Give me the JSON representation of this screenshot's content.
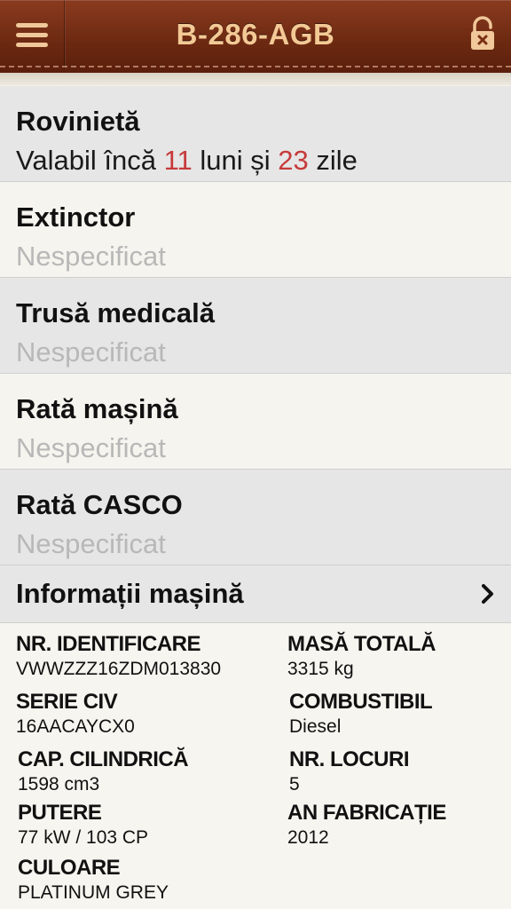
{
  "header": {
    "title": "B-286-AGB",
    "menu_icon": "hamburger-menu-icon",
    "lock_icon": "lock-icon",
    "accent_color": "#f3c995",
    "background_color": "#6e2a12"
  },
  "rows": [
    {
      "label": "Rovinietă",
      "value_prefix": "Valabil încă ",
      "months": "11",
      "months_text": " luni și ",
      "days": "23",
      "days_text": " zile"
    },
    {
      "label": "Extinctor",
      "value": "Nespecificat"
    },
    {
      "label": "Trusă medicală",
      "value": "Nespecificat"
    },
    {
      "label": "Rată mașină",
      "value": "Nespecificat"
    },
    {
      "label": "Rată CASCO",
      "value": "Nespecificat"
    }
  ],
  "info": {
    "label": "Informații mașină",
    "chevron_icon": "chevron-right-icon"
  },
  "details": {
    "identificare": {
      "key": "NR. IDENTIFICARE",
      "value": "VWWZZZ16ZDM013830"
    },
    "masa": {
      "key": "MASĂ TOTALĂ",
      "value": "3315 kg"
    },
    "serie": {
      "key": "SERIE CIV",
      "value": "16AACAYCX0"
    },
    "combustibil": {
      "key": "COMBUSTIBIL",
      "value": "Diesel"
    },
    "cilindrica": {
      "key": "CAP. CILINDRICĂ",
      "value": "1598 cm3"
    },
    "locuri": {
      "key": "NR. LOCURI",
      "value": "5"
    },
    "putere": {
      "key": "PUTERE",
      "value": "77 kW / 103 CP"
    },
    "an": {
      "key": "AN FABRICAȚIE",
      "value": "2012"
    },
    "culoare": {
      "key": "CULOARE",
      "value": "PLATINUM GREY"
    }
  }
}
